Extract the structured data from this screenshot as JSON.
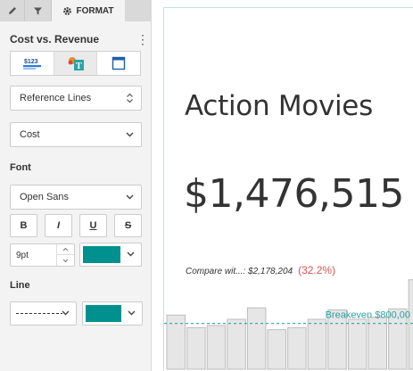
{
  "panel": {
    "tabs": [
      {
        "name": "edit",
        "icon": "pencil-icon"
      },
      {
        "name": "filter",
        "icon": "filter-icon"
      },
      {
        "name": "format",
        "icon": "gear-icon",
        "label": "FORMAT"
      }
    ],
    "title": "Cost vs. Revenue",
    "viz_buttons": [
      {
        "icon": "number-viz-icon",
        "label": "$123"
      },
      {
        "icon": "text-format-icon",
        "label": "T"
      },
      {
        "icon": "tile-layout-icon"
      }
    ],
    "reference_lines": "Reference Lines",
    "measure": "Cost",
    "font_label": "Font",
    "font_family": "Open Sans",
    "style_buttons": [
      "B",
      "I",
      "U",
      "S"
    ],
    "font_size": "9pt",
    "font_color": "#00918f",
    "line_label": "Line",
    "line_color": "#00918f"
  },
  "tile": {
    "title": "Action Movies",
    "value": "$1,476,515",
    "compare_text": "Compare wit...: $2,178,204",
    "compare_pct": "(32.2%)",
    "pct_color": "#d9534f"
  },
  "chart_data": {
    "type": "bar",
    "values": [
      52,
      40,
      42,
      48,
      59,
      38,
      40,
      48,
      57,
      48,
      50,
      58,
      86
    ],
    "ylim": [
      0,
      120
    ],
    "reference_line": {
      "label": "Breakeven $800,00",
      "value": 44,
      "color": "#2aa3a3"
    },
    "bar_color": "#e6e6e6",
    "bar_stroke": "#bdbdbd"
  }
}
